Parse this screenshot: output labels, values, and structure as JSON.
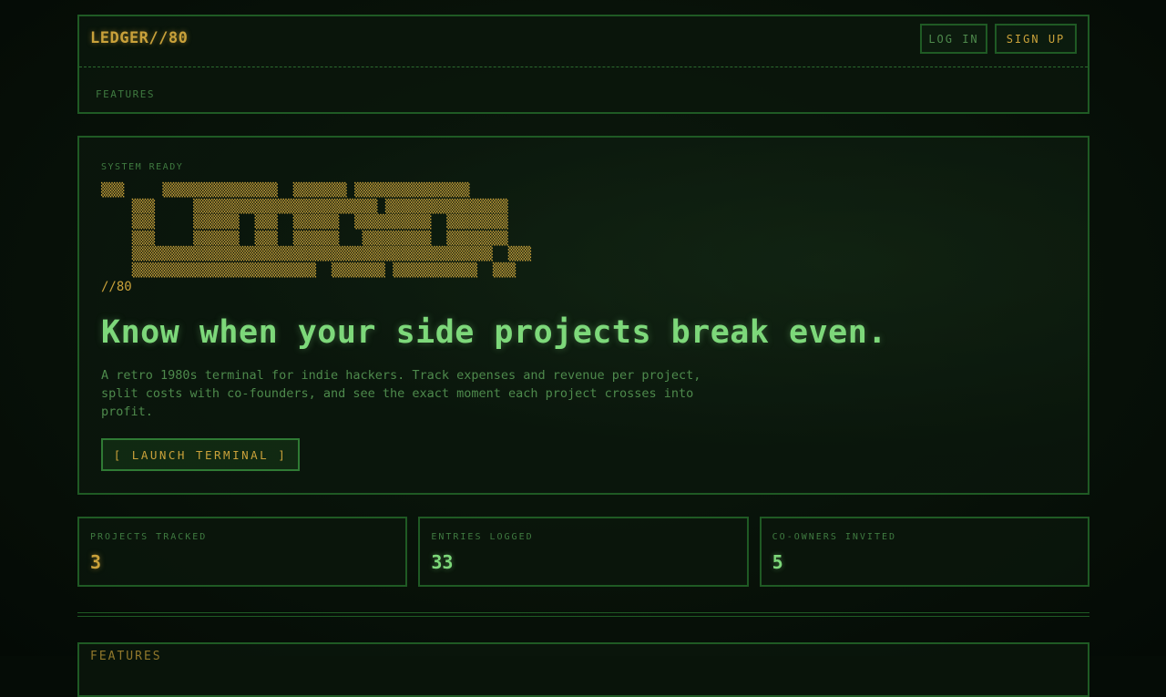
{
  "header": {
    "brand": "LEDGER//80",
    "login_label": "LOG IN",
    "signup_label": "SIGN UP",
    "nav_features": "FEATURES"
  },
  "hero": {
    "status": "SYSTEM READY",
    "ascii_art": "▒▒▒     ▒▒▒▒▒▒▒▒▒▒▒▒▒▒▒  ▒▒▒▒▒▒▒ ▒▒▒▒▒▒▒▒▒▒▒▒▒▒▒\n    ▒▒▒     ▒▒▒▒▒▒▒▒▒▒▒▒▒▒▒▒▒▒▒▒▒▒▒▒ ▒▒▒▒▒▒▒▒▒▒▒▒▒▒▒▒\n    ▒▒▒     ▒▒▒▒▒▒  ▒▒▒  ▒▒▒▒▒▒  ▒▒▒▒▒▒▒▒▒▒  ▒▒▒▒▒▒▒▒\n    ▒▒▒     ▒▒▒▒▒▒  ▒▒▒  ▒▒▒▒▒▒   ▒▒▒▒▒▒▒▒▒  ▒▒▒▒▒▒▒▒\n    ▒▒▒▒▒▒▒▒▒▒▒▒▒▒▒▒▒▒▒▒▒▒▒▒▒▒▒▒▒▒▒▒▒▒▒▒▒▒▒▒▒▒▒▒▒▒▒  ▒▒▒\n    ▒▒▒▒▒▒▒▒▒▒▒▒▒▒▒▒▒▒▒▒▒▒▒▒  ▒▒▒▒▒▒▒ ▒▒▒▒▒▒▒▒▒▒▒  ▒▒▒\n//80",
    "headline": "Know when your side projects break even.",
    "lede": "A retro 1980s terminal for indie hackers. Track expenses and revenue per project, split costs with co-founders, and see the exact moment each project crosses into profit.",
    "cta_label": "[ LAUNCH TERMINAL ]"
  },
  "stats": [
    {
      "label": "PROJECTS TRACKED",
      "value": "3",
      "tone": "amber"
    },
    {
      "label": "ENTRIES LOGGED",
      "value": "33",
      "tone": "green"
    },
    {
      "label": "CO-OWNERS INVITED",
      "value": "5",
      "tone": "green"
    }
  ],
  "features_section": {
    "title": "FEATURES"
  },
  "colors": {
    "background": "#050c06",
    "border": "#1f5a24",
    "amber": "#c9a13a",
    "green": "#7dd87a",
    "muted": "#4e8a4c"
  }
}
